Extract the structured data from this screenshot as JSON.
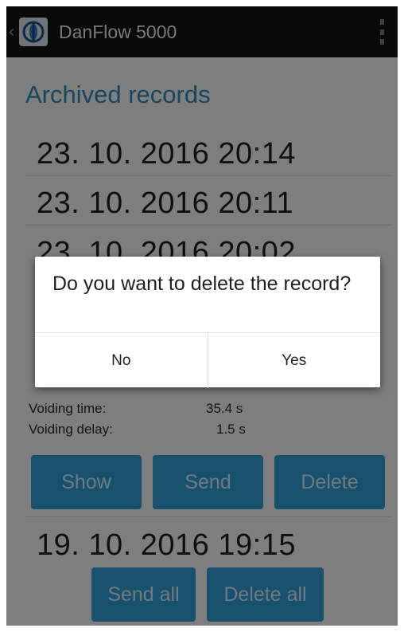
{
  "appbar": {
    "title": "DanFlow 5000"
  },
  "main": {
    "section_title": "Archived records",
    "records": [
      "23. 10. 2016  20:14",
      "23. 10. 2016  20:11",
      "23. 10. 2016  20:02",
      "19. 10. 2016  19:15"
    ],
    "details": [
      {
        "label": "Voiding time:",
        "value": "35.4 s"
      },
      {
        "label": "Voiding delay:",
        "value": "1.5 s"
      }
    ],
    "buttons": {
      "show": "Show",
      "send": "Send",
      "delete": "Delete"
    },
    "footer": {
      "send_all": "Send all",
      "delete_all": "Delete all"
    }
  },
  "dialog": {
    "message": "Do you want to delete the record?",
    "no": "No",
    "yes": "Yes"
  },
  "colors": {
    "accent": "#2e86b6",
    "button": "#2e9bd1",
    "appbar": "#131313"
  }
}
